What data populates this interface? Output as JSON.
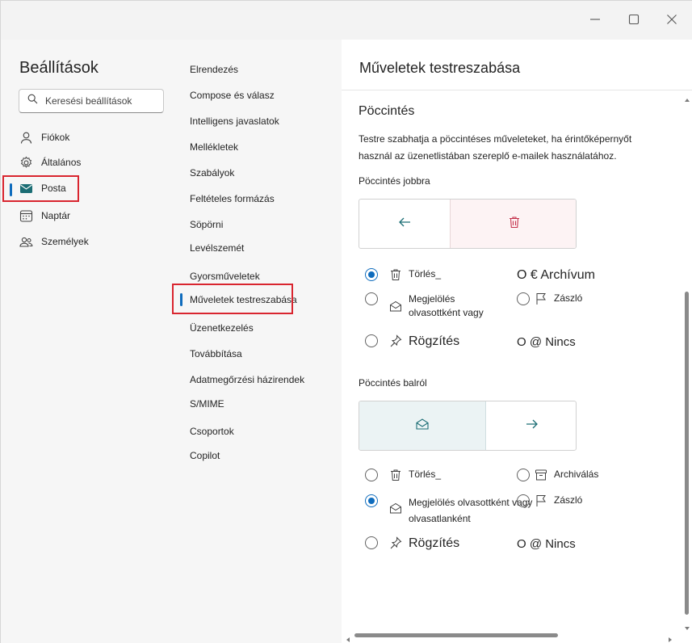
{
  "window": {
    "controls": {
      "minimize_icon": "minimize-icon",
      "maximize_icon": "maximize-icon",
      "close_icon": "close-icon"
    }
  },
  "leftnav": {
    "title": "Beállítások",
    "search": {
      "placeholder": "Keresési beállítások",
      "icon": "search-icon"
    },
    "items": [
      {
        "label": "Fiókok",
        "icon": "person-icon"
      },
      {
        "label": "Általános",
        "icon": "gear-icon"
      },
      {
        "label": "Posta",
        "icon": "mail-icon",
        "selected": true
      },
      {
        "label": "Naptár",
        "icon": "calendar-icon"
      },
      {
        "label": "Személyek",
        "icon": "people-icon"
      }
    ]
  },
  "midnav": {
    "items": [
      {
        "label": "Elrendezés"
      },
      {
        "label": "Compose és válasz"
      },
      {
        "label": "Intelligens javaslatok"
      },
      {
        "label": "Mellékletek"
      },
      {
        "label": "Szabályok"
      },
      {
        "label": "Feltételes formázás"
      },
      {
        "label": "Söpörni"
      },
      {
        "label": "Levélszemét"
      },
      {
        "label": "Gyorsműveletek"
      },
      {
        "label": "Műveletek testreszabása",
        "selected": true
      },
      {
        "label": "Üzenetkezelés"
      },
      {
        "label": "Továbbítása"
      },
      {
        "label": "Adatmegőrzési házirendek"
      },
      {
        "label": "S/MIME"
      },
      {
        "label": "Csoportok"
      },
      {
        "label": "Copilot"
      }
    ]
  },
  "main": {
    "title": "Műveletek testreszabása",
    "section_title": "Pöccintés",
    "description": "Testre szabhatja a pöccintéses műveleteket, ha érintőképernyőt használ az üzenetlistában szereplő e-mailek használatához.",
    "swipe_right": {
      "label": "Pöccintés jobbra",
      "preview_left_icon": "arrow-left-icon",
      "preview_right_icon": "delete-icon",
      "options": {
        "delete": {
          "label": "Törlés_",
          "icon": "delete-icon",
          "checked": true
        },
        "archive_raw": "O € Archívum",
        "mark_read": {
          "label": "Megjelölés olvasottként vagy",
          "icon": "mail-open-icon",
          "checked": false
        },
        "flag": {
          "label": "Zászló",
          "icon": "flag-icon",
          "checked": false
        },
        "pin": {
          "label": "Rögzítés",
          "icon": "pin-icon",
          "checked": false
        },
        "none_raw": "O @ Nincs"
      }
    },
    "swipe_left": {
      "label": "Pöccintés balról",
      "preview_left_icon": "mail-open-icon",
      "preview_right_icon": "arrow-right-icon",
      "options": {
        "delete": {
          "label": "Törlés_",
          "icon": "delete-icon",
          "checked": false
        },
        "archive": {
          "label": "Archiválás",
          "icon": "archive-icon",
          "checked": false
        },
        "mark_read": {
          "label": "Megjelölés olvasottként vagy olvasatlanként",
          "icon": "mail-open-icon",
          "checked": true
        },
        "flag": {
          "label": "Zászló",
          "icon": "flag-icon",
          "checked": false
        },
        "pin": {
          "label": "Rögzítés",
          "icon": "pin-icon",
          "checked": false
        },
        "none_raw": "O @ Nincs"
      }
    }
  },
  "colors": {
    "accent": "#0f6cbd",
    "highlight_box": "#d9252f",
    "delete_preview_bg": "#fdf3f4",
    "delete_icon": "#c4314b",
    "read_preview_bg": "#ebf3f4",
    "teal_icon": "#1b6d74"
  }
}
